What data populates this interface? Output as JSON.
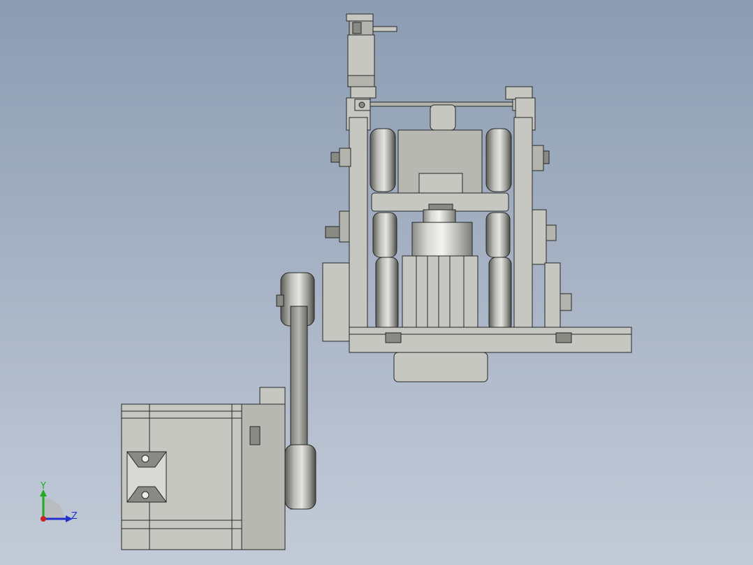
{
  "viewport": {
    "background_top": "#8c9cb2",
    "background_bottom": "#c3cbd8"
  },
  "model": {
    "body_color": "#c7c7c2",
    "mid_color": "#b4b4ae",
    "dark_color": "#6e6e6a",
    "edge_color": "#262626",
    "highlight_color": "#ececea"
  },
  "triad": {
    "y_label": "Y",
    "z_label": "Z",
    "y_color": "#22aa22",
    "z_color": "#2233cc",
    "x_color": "#cc2222"
  }
}
